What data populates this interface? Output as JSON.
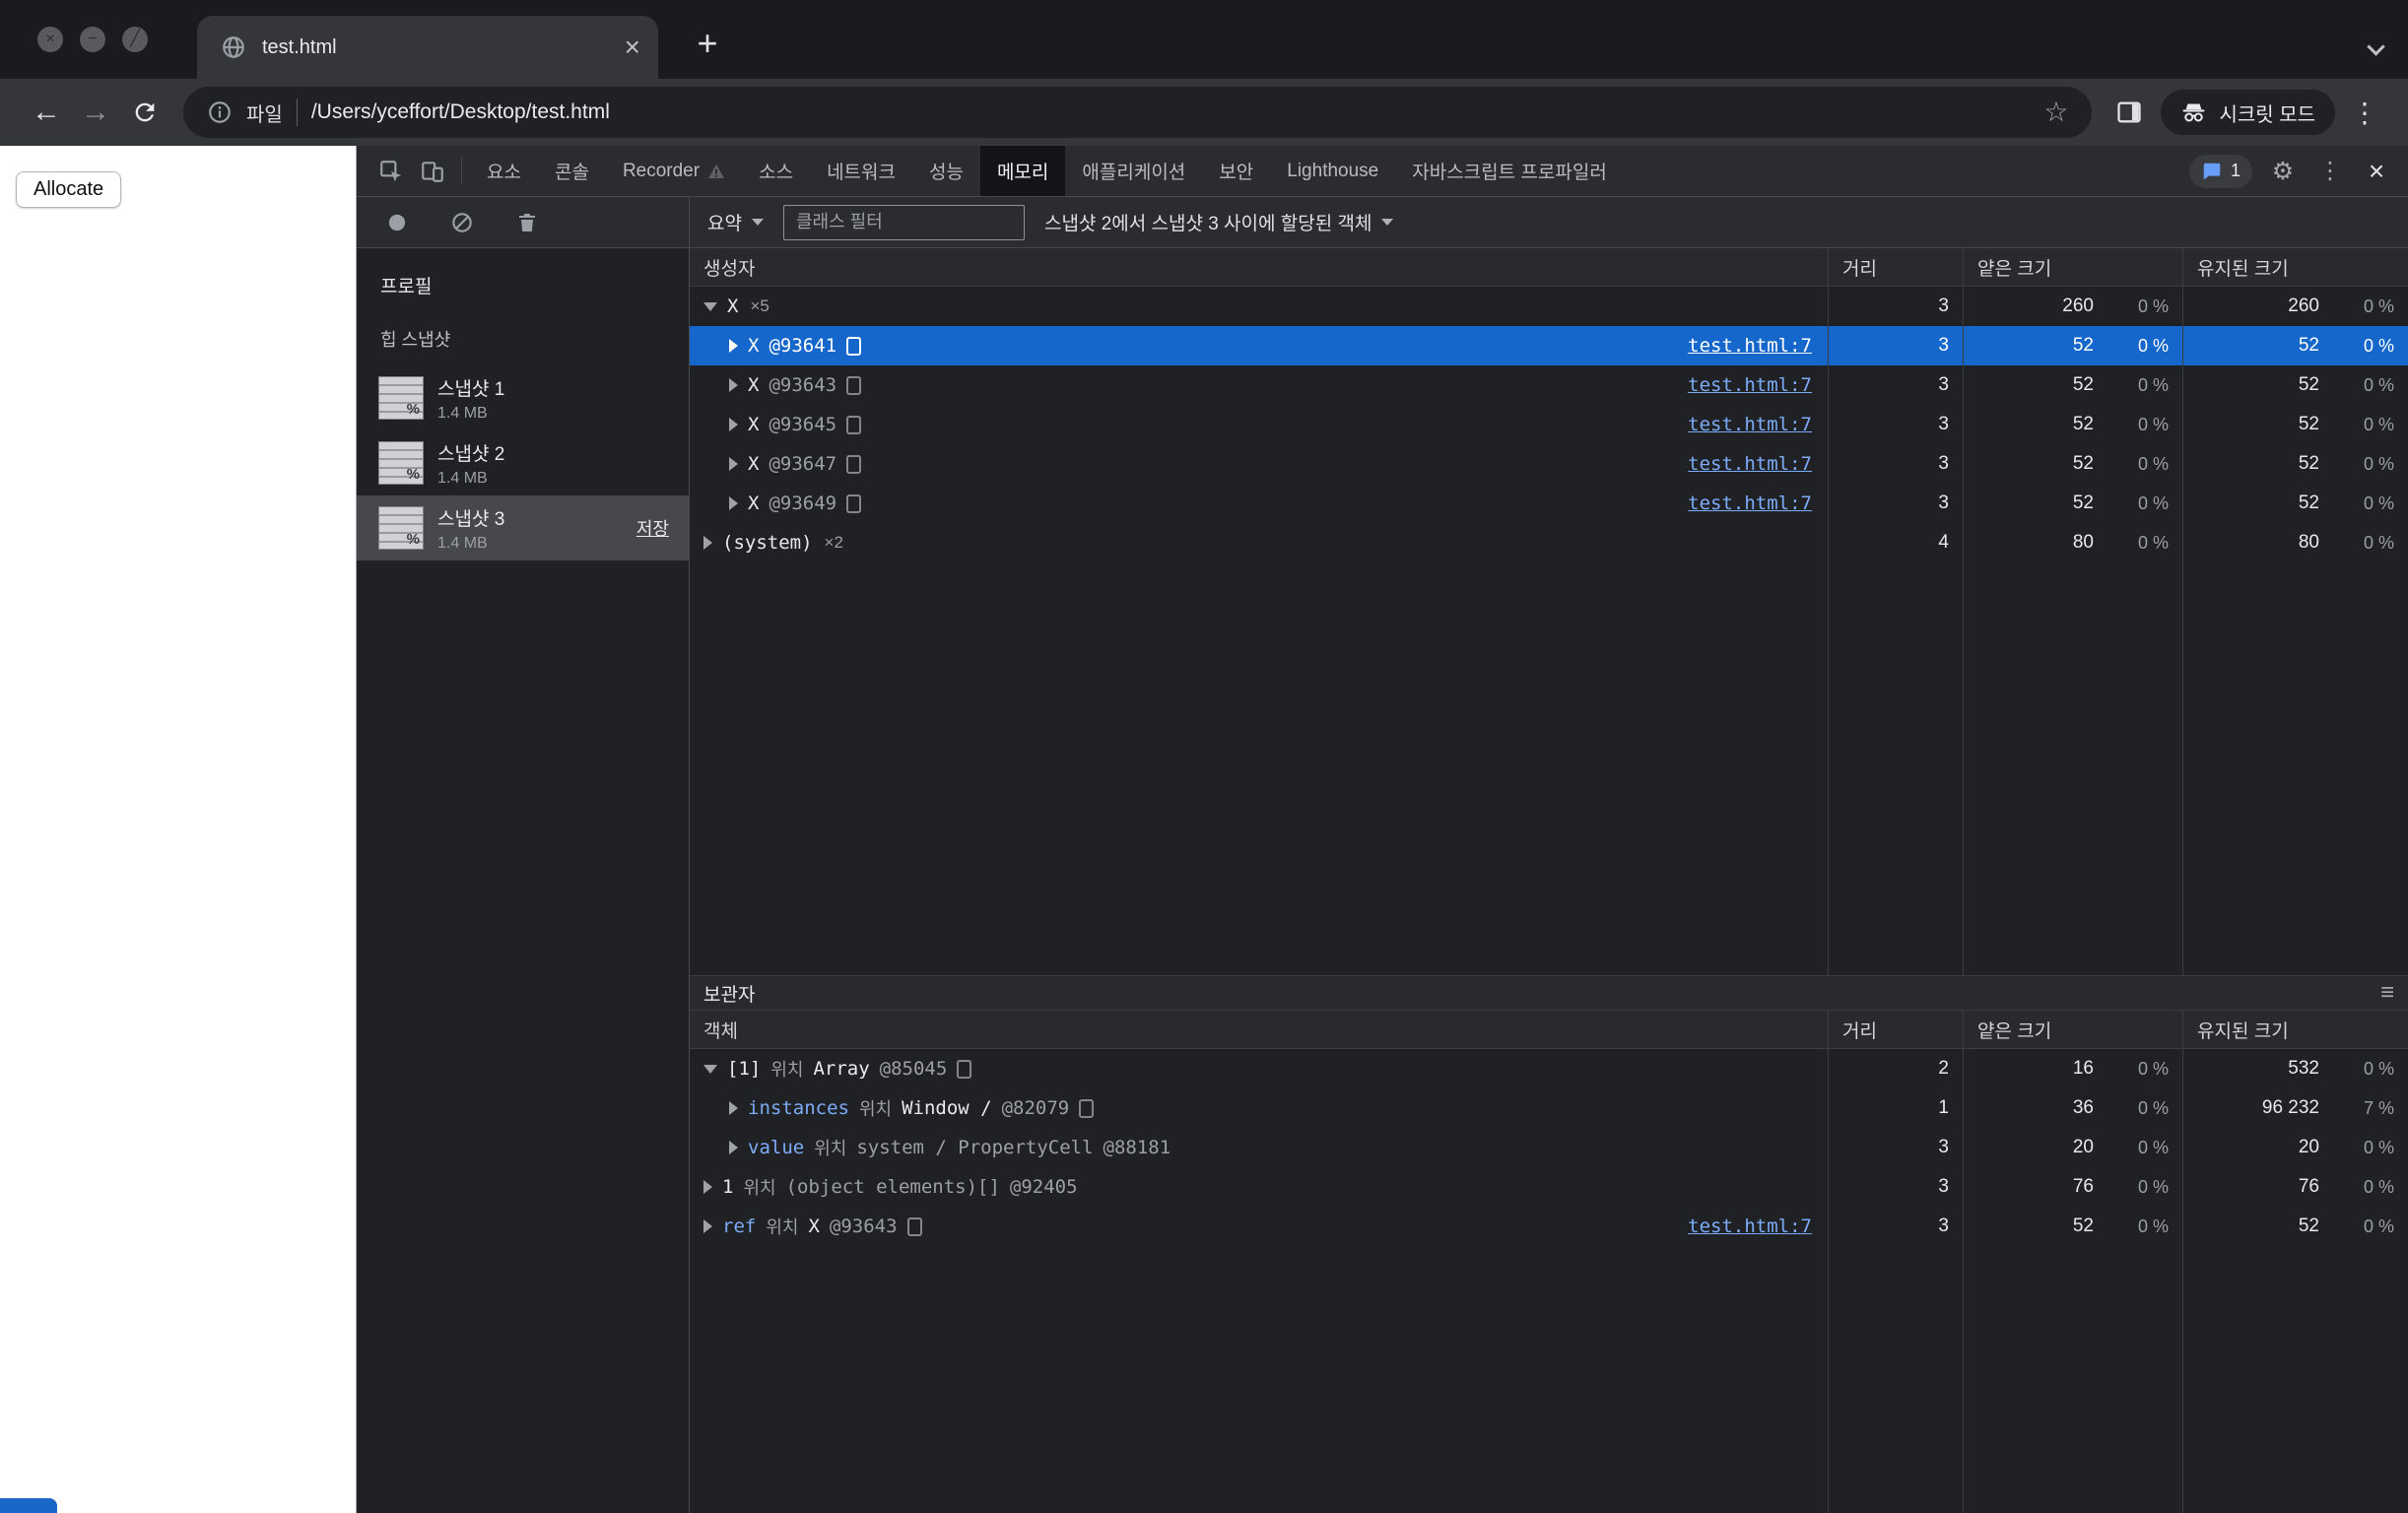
{
  "browser": {
    "tab_title": "test.html",
    "url": "/Users/yceffort/Desktop/test.html",
    "file_chip": "파일",
    "incognito_label": "시크릿 모드"
  },
  "glyphs": {
    "window_close": "×",
    "window_minimize": "−",
    "window_zoom": "╱",
    "tab_close": "×",
    "new_tab": "+",
    "back": "←",
    "forward": "→",
    "star": "☆",
    "kebab": "⋮",
    "gear": "⚙",
    "devtools_close": "×",
    "hamburger": "≡"
  },
  "page": {
    "allocate_button": "Allocate"
  },
  "devtools": {
    "issues_count": "1",
    "tabs": [
      {
        "label": "요소"
      },
      {
        "label": "콘솔"
      },
      {
        "label": "Recorder",
        "badge_icon": "warning"
      },
      {
        "label": "소스"
      },
      {
        "label": "네트워크"
      },
      {
        "label": "성능"
      },
      {
        "label": "메모리",
        "selected": true
      },
      {
        "label": "애플리케이션"
      },
      {
        "label": "보안"
      },
      {
        "label": "Lighthouse"
      },
      {
        "label": "자바스크립트 프로파일러"
      }
    ],
    "memory_toolbar": {
      "summary_label": "요약",
      "filter_placeholder": "클래스 필터",
      "range_label": "스냅샷 2에서 스냅샷 3 사이에 할당된 객체"
    },
    "sidebar": {
      "profiles_label": "프로필",
      "heap_section_label": "힙 스냅샷",
      "snapshots": [
        {
          "name": "스냅샷 1",
          "size": "1.4 MB"
        },
        {
          "name": "스냅샷 2",
          "size": "1.4 MB"
        },
        {
          "name": "스냅샷 3",
          "size": "1.4 MB",
          "selected": true,
          "save_label": "저장"
        }
      ]
    },
    "constructor_table": {
      "headers": {
        "name": "생성자",
        "distance": "거리",
        "shallow": "얕은 크기",
        "retained": "유지된 크기"
      },
      "rows": [
        {
          "expanded": true,
          "level": 0,
          "name": "X",
          "count_badge": "×5",
          "distance": "3",
          "shallow": "260",
          "shallow_pct": "0 %",
          "retained": "260",
          "retained_pct": "0 %"
        },
        {
          "expanded": false,
          "level": 1,
          "name": "X",
          "object_id": "@93641",
          "has_icon": true,
          "source_link": "test.html:7",
          "selected": true,
          "distance": "3",
          "shallow": "52",
          "shallow_pct": "0 %",
          "retained": "52",
          "retained_pct": "0 %"
        },
        {
          "expanded": false,
          "level": 1,
          "name": "X",
          "object_id": "@93643",
          "has_icon": true,
          "source_link": "test.html:7",
          "distance": "3",
          "shallow": "52",
          "shallow_pct": "0 %",
          "retained": "52",
          "retained_pct": "0 %"
        },
        {
          "expanded": false,
          "level": 1,
          "name": "X",
          "object_id": "@93645",
          "has_icon": true,
          "source_link": "test.html:7",
          "distance": "3",
          "shallow": "52",
          "shallow_pct": "0 %",
          "retained": "52",
          "retained_pct": "0 %"
        },
        {
          "expanded": false,
          "level": 1,
          "name": "X",
          "object_id": "@93647",
          "has_icon": true,
          "source_link": "test.html:7",
          "distance": "3",
          "shallow": "52",
          "shallow_pct": "0 %",
          "retained": "52",
          "retained_pct": "0 %"
        },
        {
          "expanded": false,
          "level": 1,
          "name": "X",
          "object_id": "@93649",
          "has_icon": true,
          "source_link": "test.html:7",
          "distance": "3",
          "shallow": "52",
          "shallow_pct": "0 %",
          "retained": "52",
          "retained_pct": "0 %"
        },
        {
          "expanded": false,
          "level": 0,
          "name": "(system)",
          "count_badge": "×2",
          "distance": "4",
          "shallow": "80",
          "shallow_pct": "0 %",
          "retained": "80",
          "retained_pct": "0 %"
        }
      ]
    },
    "retainers": {
      "section_label": "보관자",
      "headers": {
        "name": "객체",
        "distance": "거리",
        "shallow": "얕은 크기",
        "retained": "유지된 크기"
      },
      "rows": [
        {
          "expanded": true,
          "level": 0,
          "prop": "[1]",
          "prop_plain": true,
          "in_word": "위치",
          "object": "Array",
          "object_id": "@85045",
          "has_icon": true,
          "distance": "2",
          "shallow": "16",
          "shallow_pct": "0 %",
          "retained": "532",
          "retained_pct": "0 %"
        },
        {
          "expanded": false,
          "level": 1,
          "prop": "instances",
          "in_word": "위치",
          "object": "Window /",
          "object_id": "@82079",
          "has_icon": true,
          "distance": "1",
          "shallow": "36",
          "shallow_pct": "0 %",
          "retained": "96 232",
          "retained_pct": "7 %"
        },
        {
          "expanded": false,
          "level": 1,
          "prop": "value",
          "in_word": "위치",
          "object": "system / PropertyCell",
          "object_dim": true,
          "object_id": "@88181",
          "distance": "3",
          "shallow": "20",
          "shallow_pct": "0 %",
          "retained": "20",
          "retained_pct": "0 %"
        },
        {
          "expanded": false,
          "level": 0,
          "prop": "1",
          "prop_plain": true,
          "in_word": "위치",
          "object": "(object elements)[]",
          "object_dim": true,
          "object_id": "@92405",
          "distance": "3",
          "shallow": "76",
          "shallow_pct": "0 %",
          "retained": "76",
          "retained_pct": "0 %"
        },
        {
          "expanded": false,
          "level": 0,
          "prop": "ref",
          "in_word": "위치",
          "object": "X",
          "object_id": "@93643",
          "has_icon": true,
          "source_link": "test.html:7",
          "distance": "3",
          "shallow": "52",
          "shallow_pct": "0 %",
          "retained": "52",
          "retained_pct": "0 %"
        }
      ]
    }
  }
}
